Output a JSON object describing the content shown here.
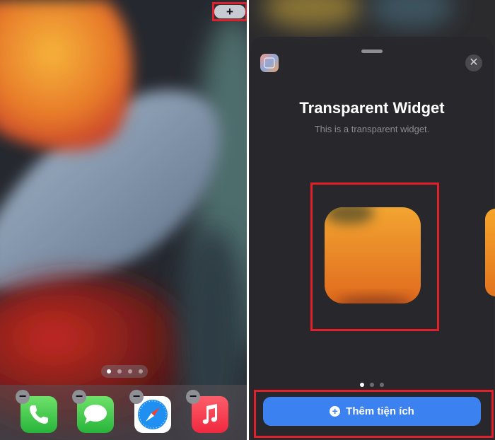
{
  "left_panel": {
    "add_button_label": "+",
    "page_dots": 4,
    "dock_apps": [
      {
        "name": "Phone"
      },
      {
        "name": "Messages"
      },
      {
        "name": "Safari"
      },
      {
        "name": "Music"
      }
    ],
    "remove_badge_label": "−"
  },
  "right_panel": {
    "close_label": "✕",
    "widget_title": "Transparent Widget",
    "widget_subtitle": "This is a transparent widget.",
    "add_widget_button_label": "Thêm tiện ích",
    "add_widget_icon": "+",
    "page_dots": 3
  },
  "colors": {
    "highlight": "#e0202a",
    "accent_button": "#3b82f0",
    "widget_gradient_top": "#f2a531",
    "widget_gradient_bottom": "#e06a1e"
  }
}
